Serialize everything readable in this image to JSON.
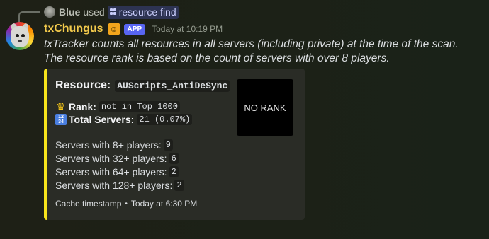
{
  "reply": {
    "user": "Blue",
    "used_text": "used",
    "command": "resource find"
  },
  "message": {
    "username": "txChungus",
    "app_badge": "APP",
    "timestamp": "Today at 10:19 PM",
    "text_line1": "txTracker counts all resources in all servers (including private) at the time of the scan.",
    "text_line2": "The resource rank is based on the count of servers with over 8 players."
  },
  "embed": {
    "accent_color": "#f7e41c",
    "title_label": "Resource:",
    "resource_name": "AUScripts_AntiDeSync",
    "rank_label": "Rank:",
    "rank_value": "not in Top 1000",
    "total_label": "Total Servers:",
    "total_value": "21 (0.07%)",
    "thumbnail_text": "NO RANK",
    "stats": [
      {
        "label": "Servers with 8+ players:",
        "value": "9"
      },
      {
        "label": "Servers with 32+ players:",
        "value": "6"
      },
      {
        "label": "Servers with 64+ players:",
        "value": "2"
      },
      {
        "label": "Servers with 128+ players:",
        "value": "2"
      }
    ],
    "footer_label": "Cache timestamp",
    "footer_time": "Today at 6:30 PM"
  },
  "icons": {
    "rank_icon": "crown-icon",
    "total_icon": "numbers-icon",
    "command_icon": "slash-command-icon"
  }
}
